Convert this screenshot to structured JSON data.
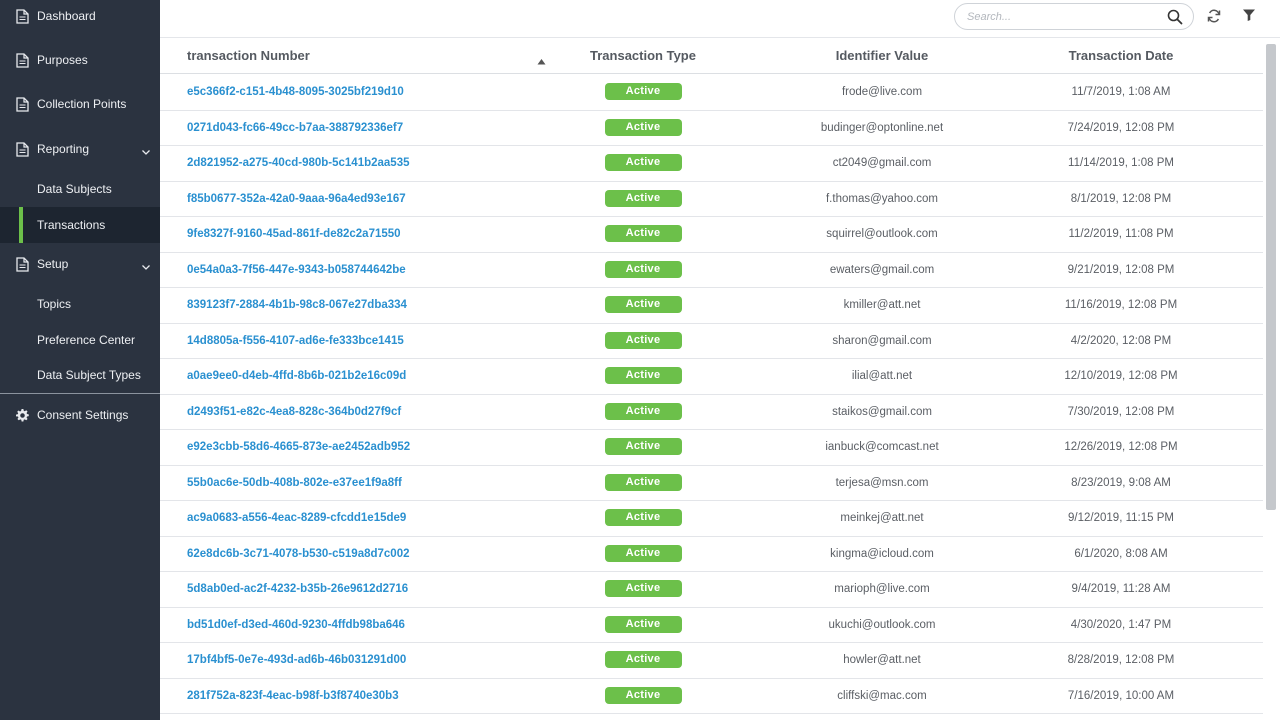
{
  "sidebar": {
    "items": [
      {
        "label": "Dashboard",
        "icon": "document-icon"
      },
      {
        "label": "Purposes",
        "icon": "document-icon"
      },
      {
        "label": "Collection Points",
        "icon": "document-icon"
      },
      {
        "label": "Reporting",
        "icon": "document-icon",
        "expanded": true
      },
      {
        "label": "Data Subjects",
        "sub": true
      },
      {
        "label": "Transactions",
        "sub": true,
        "active": true
      },
      {
        "label": "Setup",
        "icon": "document-icon",
        "expanded": true
      },
      {
        "label": "Topics",
        "sub": true
      },
      {
        "label": "Preference Center",
        "sub": true
      },
      {
        "label": "Data Subject Types",
        "sub": true
      },
      {
        "label": "Consent Settings",
        "icon": "gear-icon"
      }
    ],
    "accent_color": "#6cc04a"
  },
  "search": {
    "placeholder": "Search..."
  },
  "table": {
    "columns": [
      "transaction Number",
      "Transaction Type",
      "Identifier Value",
      "Transaction Date"
    ],
    "sort": {
      "column": "transaction Number",
      "direction": "ascending"
    },
    "rows": [
      {
        "id": "e5c366f2-c151-4b48-8095-3025bf219d10",
        "type": "Active",
        "identifier": "frode@live.com",
        "date": "11/7/2019, 1:08 AM"
      },
      {
        "id": "0271d043-fc66-49cc-b7aa-388792336ef7",
        "type": "Active",
        "identifier": "budinger@optonline.net",
        "date": "7/24/2019, 12:08 PM"
      },
      {
        "id": "2d821952-a275-40cd-980b-5c141b2aa535",
        "type": "Active",
        "identifier": "ct2049@gmail.com",
        "date": "11/14/2019, 1:08 PM"
      },
      {
        "id": "f85b0677-352a-42a0-9aaa-96a4ed93e167",
        "type": "Active",
        "identifier": "f.thomas@yahoo.com",
        "date": "8/1/2019, 12:08 PM"
      },
      {
        "id": "9fe8327f-9160-45ad-861f-de82c2a71550",
        "type": "Active",
        "identifier": "squirrel@outlook.com",
        "date": "11/2/2019, 11:08 PM"
      },
      {
        "id": "0e54a0a3-7f56-447e-9343-b058744642be",
        "type": "Active",
        "identifier": "ewaters@gmail.com",
        "date": "9/21/2019, 12:08 PM"
      },
      {
        "id": "839123f7-2884-4b1b-98c8-067e27dba334",
        "type": "Active",
        "identifier": "kmiller@att.net",
        "date": "11/16/2019, 12:08 PM"
      },
      {
        "id": "14d8805a-f556-4107-ad6e-fe333bce1415",
        "type": "Active",
        "identifier": "sharon@gmail.com",
        "date": "4/2/2020, 12:08 PM"
      },
      {
        "id": "a0ae9ee0-d4eb-4ffd-8b6b-021b2e16c09d",
        "type": "Active",
        "identifier": "ilial@att.net",
        "date": "12/10/2019, 12:08 PM"
      },
      {
        "id": "d2493f51-e82c-4ea8-828c-364b0d27f9cf",
        "type": "Active",
        "identifier": "staikos@gmail.com",
        "date": "7/30/2019, 12:08 PM"
      },
      {
        "id": "e92e3cbb-58d6-4665-873e-ae2452adb952",
        "type": "Active",
        "identifier": "ianbuck@comcast.net",
        "date": "12/26/2019, 12:08 PM"
      },
      {
        "id": "55b0ac6e-50db-408b-802e-e37ee1f9a8ff",
        "type": "Active",
        "identifier": "terjesa@msn.com",
        "date": "8/23/2019, 9:08 AM"
      },
      {
        "id": "ac9a0683-a556-4eac-8289-cfcdd1e15de9",
        "type": "Active",
        "identifier": "meinkej@att.net",
        "date": "9/12/2019, 11:15 PM"
      },
      {
        "id": "62e8dc6b-3c71-4078-b530-c519a8d7c002",
        "type": "Active",
        "identifier": "kingma@icloud.com",
        "date": "6/1/2020, 8:08 AM"
      },
      {
        "id": "5d8ab0ed-ac2f-4232-b35b-26e9612d2716",
        "type": "Active",
        "identifier": "marioph@live.com",
        "date": "9/4/2019, 11:28 AM"
      },
      {
        "id": "bd51d0ef-d3ed-460d-9230-4ffdb98ba646",
        "type": "Active",
        "identifier": "ukuchi@outlook.com",
        "date": "4/30/2020, 1:47 PM"
      },
      {
        "id": "17bf4bf5-0e7e-493d-ad6b-46b031291d00",
        "type": "Active",
        "identifier": "howler@att.net",
        "date": "8/28/2019, 12:08 PM"
      },
      {
        "id": "281f752a-823f-4eac-b98f-b3f8740e30b3",
        "type": "Active",
        "identifier": "cliffski@mac.com",
        "date": "7/16/2019, 10:00 AM"
      }
    ]
  },
  "colors": {
    "sidebar_bg": "#2b3340",
    "link": "#2a90d0",
    "badge_active": "#6cc04a"
  }
}
